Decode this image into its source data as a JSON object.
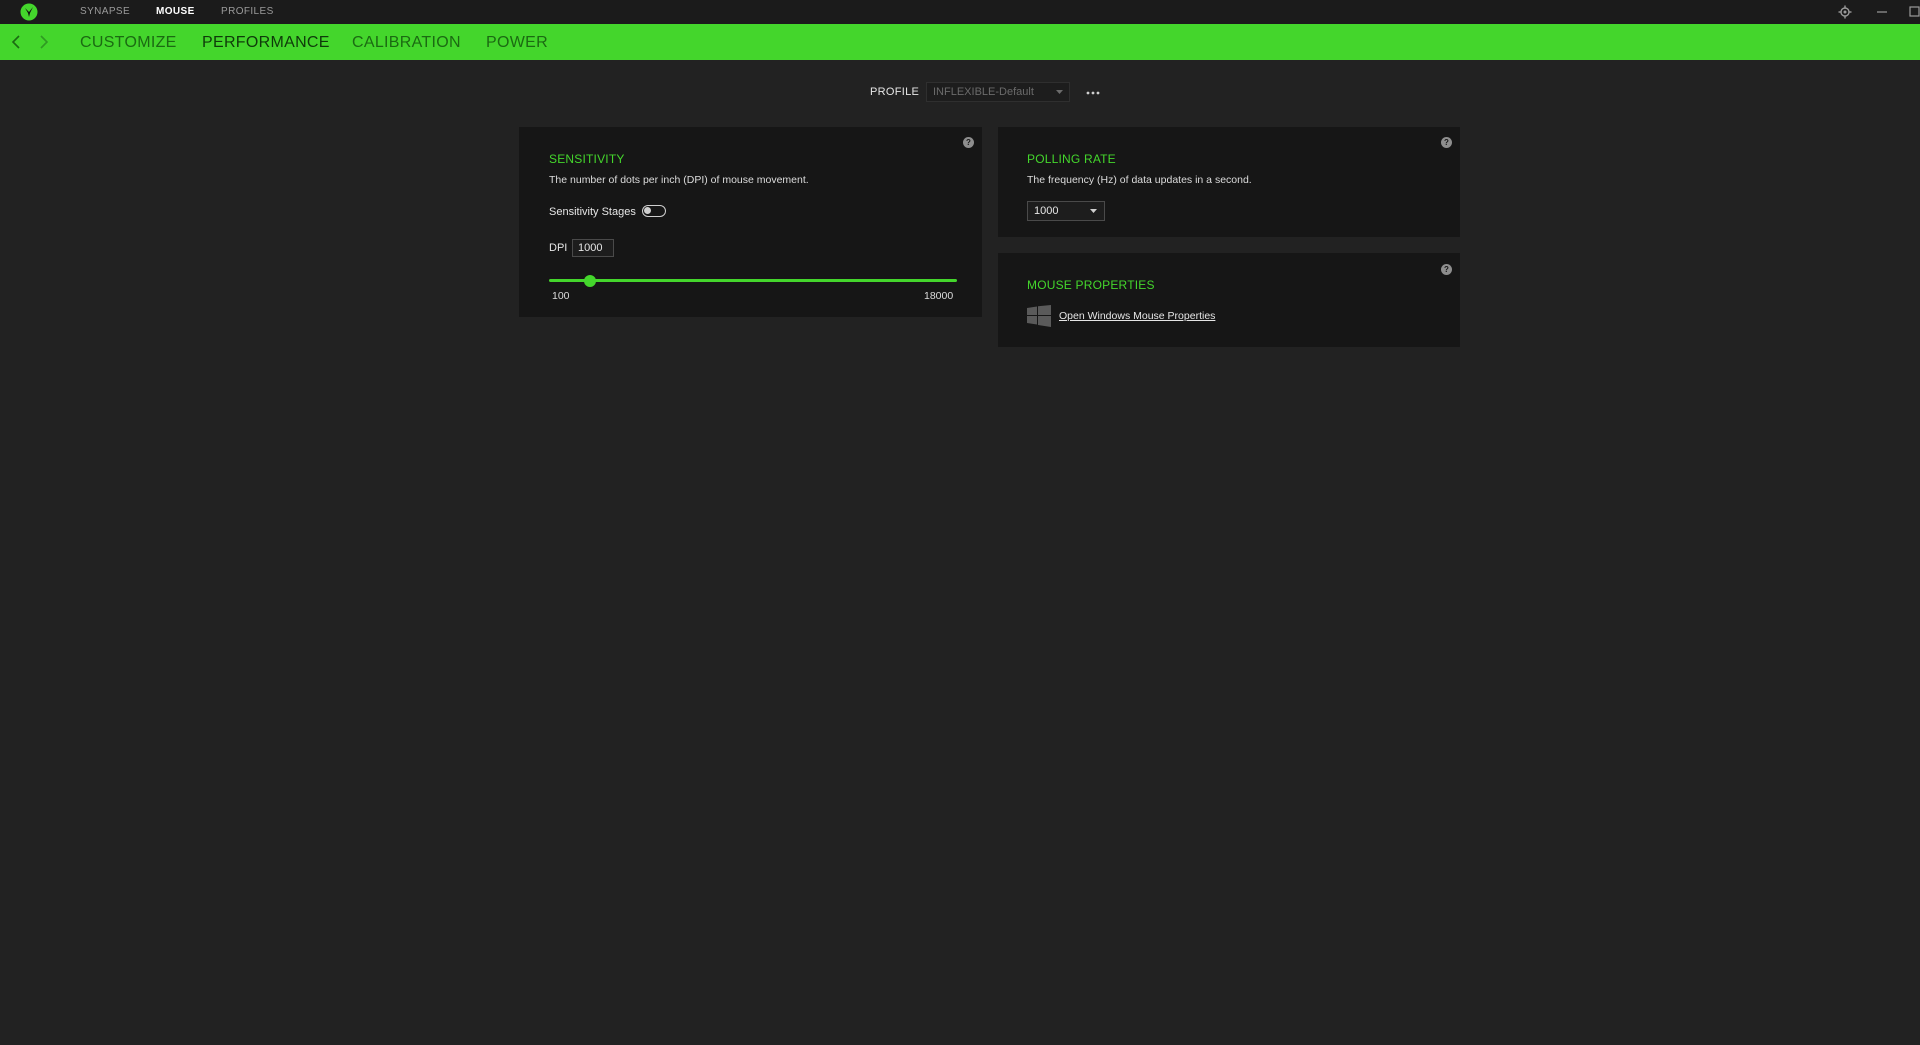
{
  "topnav": {
    "items": [
      "SYNAPSE",
      "MOUSE",
      "PROFILES"
    ],
    "active": "MOUSE"
  },
  "tabs": {
    "items": [
      "CUSTOMIZE",
      "PERFORMANCE",
      "CALIBRATION",
      "POWER"
    ],
    "active": "PERFORMANCE"
  },
  "profile": {
    "label": "PROFILE",
    "selected": "INFLEXIBLE-Default",
    "more": "•••"
  },
  "sensitivity": {
    "title": "SENSITIVITY",
    "description": "The number of dots per inch (DPI) of mouse movement.",
    "stages_label": "Sensitivity Stages",
    "stages_enabled": false,
    "dpi_label": "DPI",
    "dpi_value": "1000",
    "min_label": "100",
    "max_label": "18000",
    "min": 100,
    "max": 18000,
    "value": 1000
  },
  "polling": {
    "title": "POLLING RATE",
    "description": "The frequency (Hz) of data updates in a second.",
    "selected": "1000"
  },
  "mouse_properties": {
    "title": "MOUSE PROPERTIES",
    "link": "Open Windows Mouse Properties"
  },
  "help_glyph": "?",
  "colors": {
    "accent": "#44d62c",
    "background": "#222222",
    "panel": "#161616",
    "titlebar": "#1b1b1b"
  }
}
